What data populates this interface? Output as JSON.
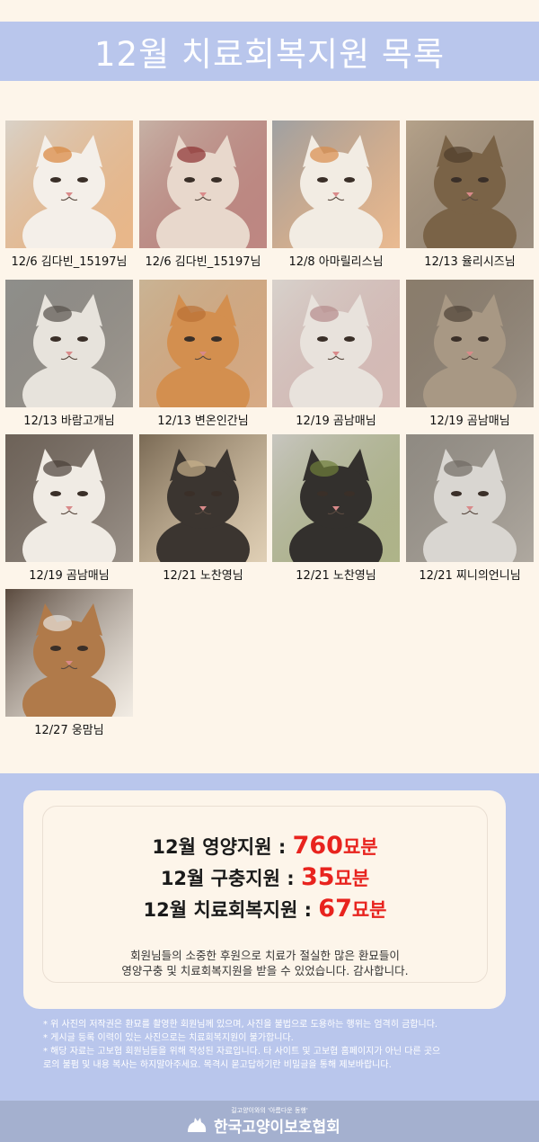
{
  "header": {
    "title": "12월 치료회복지원 목록"
  },
  "photos": [
    {
      "caption": "12/6 김다빈_15197님",
      "bg": "#d9d2c8",
      "cat": "#f4efe9",
      "accent": "#d9853b"
    },
    {
      "caption": "12/6 김다빈_15197님",
      "bg": "#c7b2a6",
      "cat": "#e8d8cc",
      "accent": "#8c2f2f"
    },
    {
      "caption": "12/8 아마릴리스님",
      "bg": "#9fa1a3",
      "cat": "#f2ece3",
      "accent": "#d98b4a"
    },
    {
      "caption": "12/13 율리시즈님",
      "bg": "#b5a28a",
      "cat": "#7a6347",
      "accent": "#4e3d2b"
    },
    {
      "caption": "12/13 바람고개님",
      "bg": "#8f8f8b",
      "cat": "#e7e3dc",
      "accent": "#55504a"
    },
    {
      "caption": "12/13 변온인간님",
      "bg": "#c9b495",
      "cat": "#d38f4f",
      "accent": "#b96f35"
    },
    {
      "caption": "12/19 곰남매님",
      "bg": "#d8d2cc",
      "cat": "#e8e2dc",
      "accent": "#b58a8a"
    },
    {
      "caption": "12/19 곰남매님",
      "bg": "#8b7d6c",
      "cat": "#a89884",
      "accent": "#4d4236"
    },
    {
      "caption": "12/19 곰남매님",
      "bg": "#6d6258",
      "cat": "#f0ebe4",
      "accent": "#4a4039"
    },
    {
      "caption": "12/21 노찬영님",
      "bg": "#7a6a55",
      "cat": "#3b3530",
      "accent": "#c7b08a"
    },
    {
      "caption": "12/21 노찬영님",
      "bg": "#c8c6c0",
      "cat": "#33302d",
      "accent": "#6f7f3a"
    },
    {
      "caption": "12/21 찌니의언니님",
      "bg": "#8f8a82",
      "cat": "#d9d6d1",
      "accent": "#6f6a63"
    },
    {
      "caption": "12/27 웅맘님",
      "bg": "#5a4a3e",
      "cat": "#b07a4a",
      "accent": "#e8e4de"
    }
  ],
  "summary": {
    "nutrition": {
      "label": "12월 영양지원 : ",
      "value": "760",
      "unit": "묘분"
    },
    "parasite": {
      "label": "12월 구충지원 : ",
      "value": "35",
      "unit": "묘분"
    },
    "treatment": {
      "label": "12월 치료회복지원 : ",
      "value": "67",
      "unit": "묘분"
    },
    "thanks_line1": "회원님들의 소중한 후원으로 치료가 절실한 많은 환묘들이",
    "thanks_line2": "영양구충 및 치료회복지원을 받을 수 있었습니다. 감사합니다."
  },
  "notes": [
    "* 위 사진의 저작권은 환묘를 촬영한 회원님께 있으며, 사진을 불법으로 도용하는 행위는 엄격히 금합니다.",
    "* 게시글 등록 이력이 있는 사진으로는 치료회복지원이 불가합니다.",
    "* 해당 자료는 고보협 회원님들을 위해 작성된 자료입니다. 타 사이트 및 고보협 홈페이지가 아닌 다른 곳으",
    "   로의 불펌 및 내용 복사는 하지말아주세요.  목격시 묻고답하기란 비밀글을 통해 제보바랍니다."
  ],
  "footer": {
    "tagline": "길고양이와의 '아름다운 동행'",
    "org_name": "한국고양이보호협회"
  }
}
